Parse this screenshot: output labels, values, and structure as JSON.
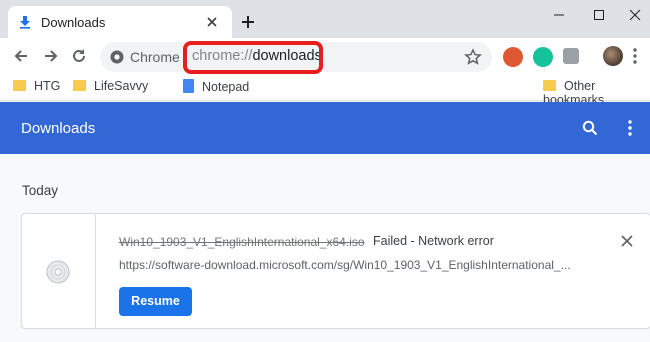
{
  "tab": {
    "title": "Downloads"
  },
  "omnibox": {
    "site_label": "Chrome",
    "url_scheme": "chrome://",
    "url_path": "downloads"
  },
  "bookmarks": [
    {
      "label": "HTG"
    },
    {
      "label": "LifeSavvy"
    },
    {
      "label": "Notepad"
    },
    {
      "label": "Other bookmarks"
    }
  ],
  "downloads": {
    "title": "Downloads",
    "section": "Today",
    "item": {
      "filename": "Win10_1903_V1_EnglishInternational_x64.iso",
      "status": "Failed - Network error",
      "url": "https://software-download.microsoft.com/sg/Win10_1903_V1_EnglishInternational_...",
      "action": "Resume"
    }
  },
  "colors": {
    "header": "#3367d6",
    "button": "#1a73e8",
    "highlight": "#e81e1e"
  }
}
